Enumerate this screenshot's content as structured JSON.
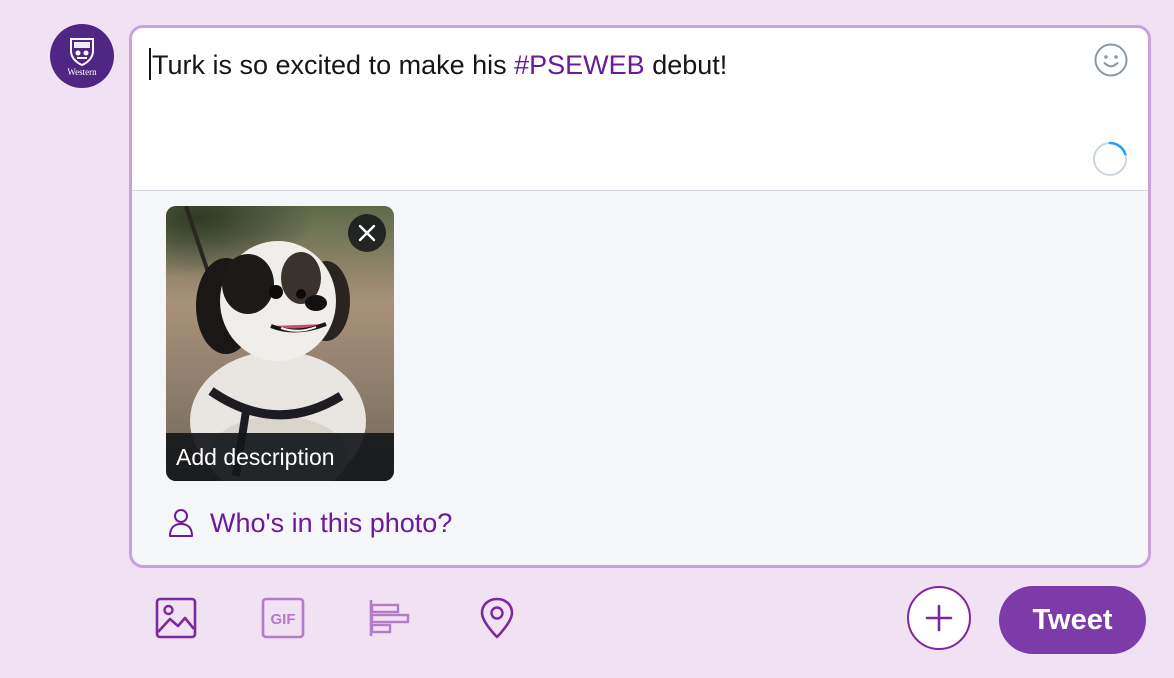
{
  "account": {
    "avatar_text": "Western"
  },
  "composer": {
    "text_plain": "Turk is so excited to make his ",
    "text_hashtag": "#PSEWEB",
    "text_after": " debut!",
    "emoji_icon": "smiley-face-icon",
    "progress_icon": "character-count-ring-icon",
    "character_progress": 0.2
  },
  "media": {
    "remove_icon": "close-icon",
    "add_description_label": "Add description",
    "photo_subject": "shih-tzu dog photo"
  },
  "tag_people": {
    "icon": "person-icon",
    "label": "Who's in this photo?"
  },
  "toolbar": {
    "icons": [
      "image-icon",
      "gif-icon",
      "poll-icon",
      "location-icon"
    ],
    "gif_label": "GIF",
    "add_thread_icon": "plus-icon",
    "tweet_label": "Tweet"
  },
  "colors": {
    "background": "#f0e1f3",
    "brand_purple": "#7d3aa9",
    "hashtag": "#6a1b9a",
    "composer_border": "#c8a2dd",
    "spinner_blue": "#1da1f2"
  }
}
